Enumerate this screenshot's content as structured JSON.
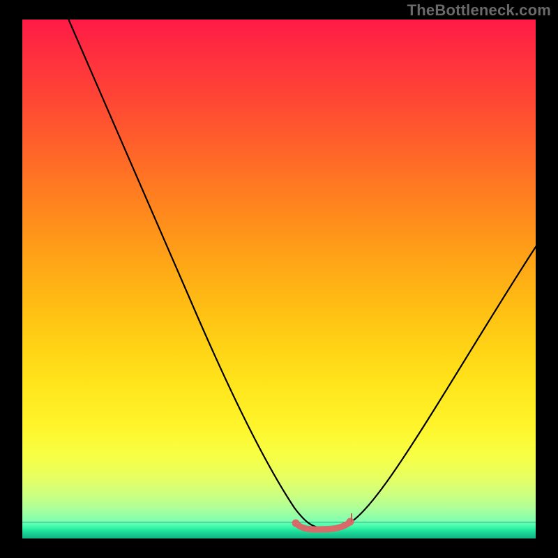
{
  "watermark": "TheBottleneck.com",
  "chart_data": {
    "type": "line",
    "title": "",
    "xlabel": "",
    "ylabel": "",
    "xlim": [
      0,
      100
    ],
    "ylim": [
      0,
      100
    ],
    "grid": false,
    "legend": false,
    "series": [
      {
        "name": "bottleneck-curve",
        "color": "#000000",
        "x": [
          12,
          16,
          20,
          24,
          28,
          32,
          36,
          40,
          44,
          48,
          52,
          56,
          58,
          60,
          62,
          64,
          68,
          72,
          76,
          80,
          84,
          88,
          92,
          96,
          100
        ],
        "values": [
          100,
          92,
          84,
          76,
          68,
          60,
          52,
          44,
          36,
          28,
          20,
          12,
          5,
          3,
          3,
          4,
          7,
          12,
          19,
          26,
          34,
          42,
          50,
          58,
          64
        ]
      }
    ],
    "annotation": {
      "name": "optimal-marker",
      "color": "#e07070",
      "x_range": [
        54,
        64
      ],
      "y": 3
    },
    "background": {
      "type": "vertical-gradient",
      "stops": [
        {
          "pos": 0,
          "color": "#ff1a47"
        },
        {
          "pos": 50,
          "color": "#ffba14"
        },
        {
          "pos": 80,
          "color": "#f7ff44"
        },
        {
          "pos": 100,
          "color": "#2dffb0"
        }
      ]
    }
  }
}
